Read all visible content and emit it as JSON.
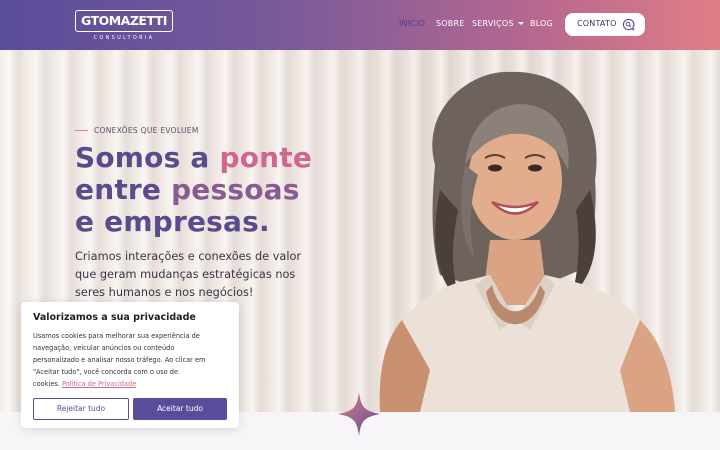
{
  "header": {
    "logo": {
      "wordmark": "GTOMAZETTI",
      "tagline": "CONSULTORIA"
    },
    "nav": [
      {
        "label": "INÍCIO",
        "active": true
      },
      {
        "label": "SOBRE"
      },
      {
        "label": "SERVIÇOS",
        "has_dropdown": true
      },
      {
        "label": "BLOG"
      }
    ],
    "contact_button": {
      "label": "CONTATO",
      "icon": "chat-search-icon"
    }
  },
  "hero": {
    "eyebrow": "CONEXÕES QUE EVOLUEM",
    "headline": {
      "line1_a": "Somos a ",
      "line1_b": "ponte",
      "line2_a": "entre ",
      "line2_b": "pessoas",
      "line3_a": "e ",
      "line3_b": "empresas."
    },
    "subtext": [
      "Criamos interações e conexões de valor",
      "que geram mudanças estratégicas nos",
      "seres humanos e nos negócios!"
    ],
    "image": "smiling-woman-photo"
  },
  "cookie_banner": {
    "title": "Valorizamos a sua privacidade",
    "text_lines": [
      "Usamos cookies para melhorar sua experiência de",
      "navegação, veicular anúncios ou conteúdo",
      "personalizado e analisar nosso tráfego. Ao clicar em",
      "\"Aceitar tudo\", você concorda com o uso de",
      "cookies. "
    ],
    "policy_link": "Política de Privacidade",
    "reject_label": "Rejeitar tudo",
    "accept_label": "Aceitar tudo"
  },
  "colors": {
    "brand_purple": "#5a4c9a",
    "brand_pink": "#d0668d",
    "header_gradient_end": "#e07e86"
  }
}
